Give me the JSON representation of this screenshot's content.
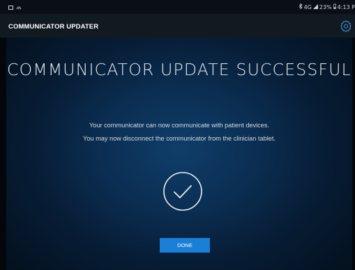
{
  "status_bar": {
    "left_icons": [
      "gallery-icon",
      "signal-icon"
    ],
    "right_text": "4G",
    "battery": "23%",
    "time": "4:13 P",
    "icons": [
      "bluetooth-icon",
      "network-icon",
      "battery-icon"
    ]
  },
  "header": {
    "title": "COMMUNICATOR UPDATER",
    "settings_icon": "gear-icon"
  },
  "main": {
    "headline": "COMMUNICATOR UPDATE SUCCESSFUL",
    "message_line1": "Your communicator can now communicate with patient devices.",
    "message_line2": "You may now disconnect the communicator from the clinician tablet.",
    "status_icon": "checkmark-circle-icon",
    "done_label": "DONE"
  },
  "colors": {
    "accent": "#1a7fd6",
    "header_bg": "#111921",
    "panel_center": "#0f3e6a",
    "panel_edge": "#04111f"
  }
}
